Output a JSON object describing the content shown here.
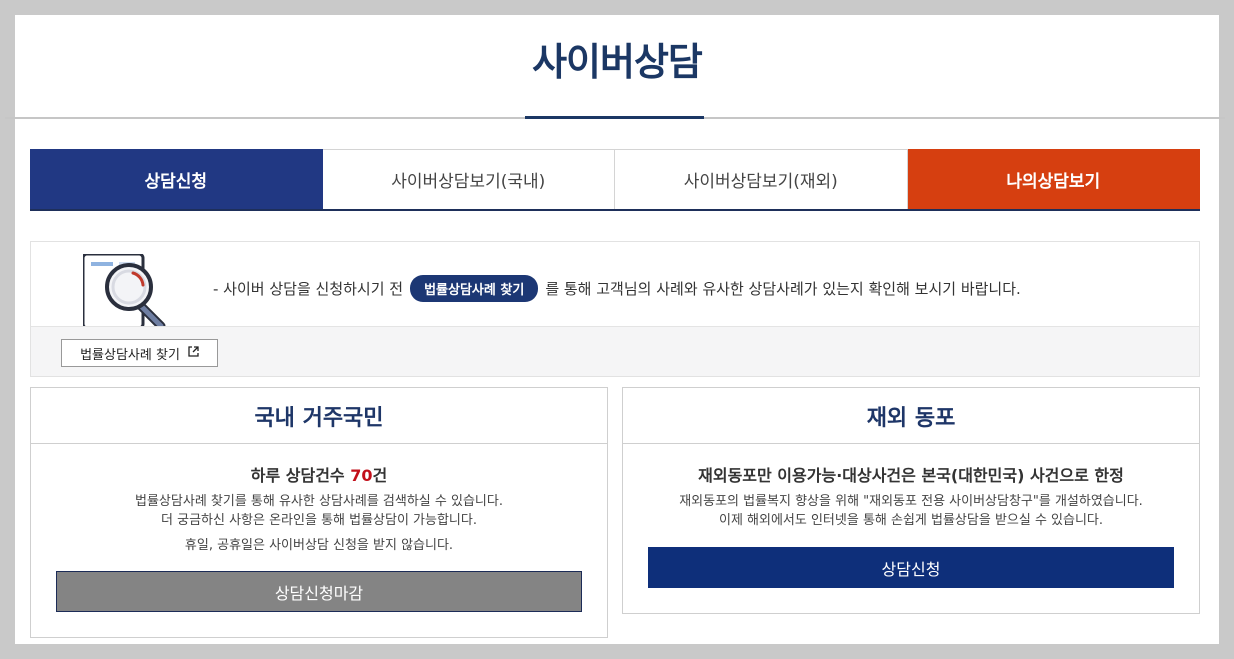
{
  "page": {
    "title": "사이버상담"
  },
  "tabs": [
    {
      "label": "상담신청"
    },
    {
      "label": "사이버상담보기(국내)"
    },
    {
      "label": "사이버상담보기(재외)"
    },
    {
      "label": "나의상담보기"
    }
  ],
  "notice": {
    "text_prefix": "- 사이버 상담을 신청하시기 전",
    "pill_label": "법률상담사례 찾기",
    "text_suffix": "를 통해 고객님의 사례와 유사한 상담사례가 있는지 확인해 보시기 바랍니다.",
    "link_label": "법률상담사례 찾기",
    "link_icon": "external-link-icon"
  },
  "domestic": {
    "title": "국내 거주국민",
    "daily_prefix": "하루 상담건수 ",
    "daily_count": "70",
    "daily_suffix": "건",
    "desc_line1": "법률상담사례 찾기를 통해 유사한 상담사례를 검색하실 수 있습니다.",
    "desc_line2": "더 궁금하신 사항은 온라인을 통해 법률상담이 가능합니다.",
    "note": "휴일, 공휴일은 사이버상담 신청을 받지 않습니다.",
    "button_label": "상담신청마감"
  },
  "overseas": {
    "title": "재외 동포",
    "subtitle": "재외동포만 이용가능·대상사건은 본국(대한민국) 사건으로 한정",
    "desc_line1": "재외동포의 법률복지 향상을 위해 \"재외동포 전용 사이버상담창구\"를 개설하였습니다.",
    "desc_line2": "이제 해외에서도 인터넷을 통해 손쉽게 법률상담을 받으실 수 있습니다.",
    "button_label": "상담신청"
  },
  "colors": {
    "brand_navy": "#1b3764",
    "tab_active": "#213883",
    "tab_orange": "#d63f10",
    "accent_red": "#c20f1a",
    "closed_button": "#848484",
    "apply_button": "#0e2f7a"
  }
}
